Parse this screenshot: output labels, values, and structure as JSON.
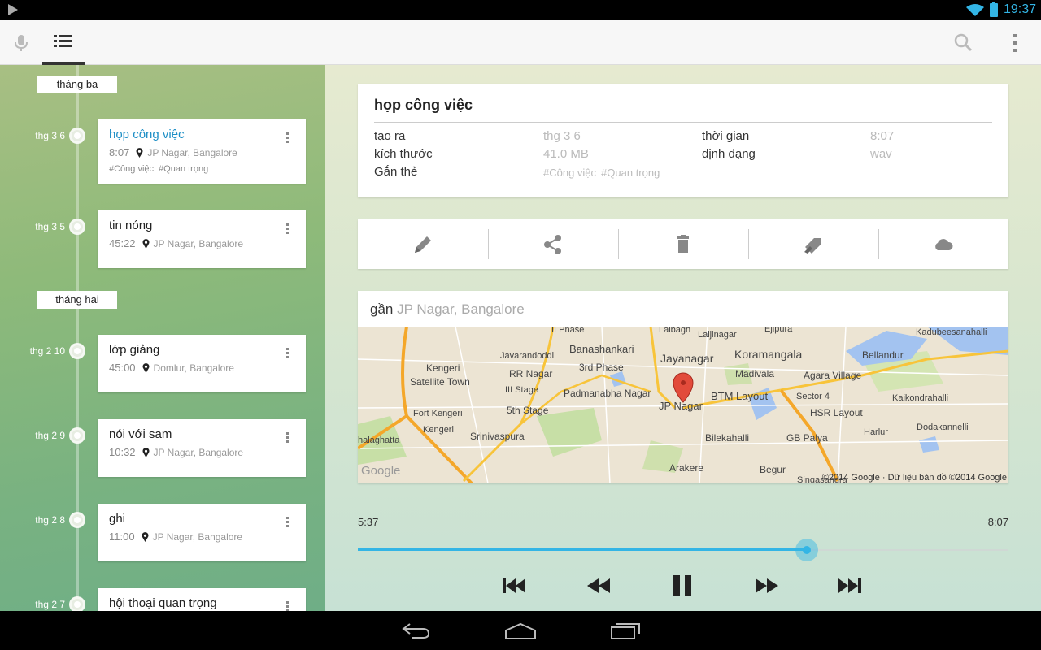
{
  "status_bar": {
    "clock": "19:37",
    "accent": "#33b5e5"
  },
  "toolbar": {
    "left_icons": [
      "mic-icon",
      "list-icon"
    ],
    "right_icons": [
      "search-icon",
      "overflow-menu-icon"
    ]
  },
  "timeline": {
    "months": [
      {
        "label": "tháng ba"
      },
      {
        "label": "tháng hai"
      }
    ],
    "recordings": [
      {
        "date": "thg 3 6",
        "title": "họp công việc",
        "time": "8:07",
        "location": "JP Nagar, Bangalore",
        "tags": [
          "#Công việc",
          "#Quan trọng"
        ],
        "active": true
      },
      {
        "date": "thg 3 5",
        "title": "tin nóng",
        "time": "45:22",
        "location": "JP Nagar, Bangalore"
      },
      {
        "date": "thg 2 10",
        "title": "lớp giảng",
        "time": "45:00",
        "location": "Domlur, Bangalore"
      },
      {
        "date": "thg 2 9",
        "title": "nói với sam",
        "time": "10:32",
        "location": "JP Nagar, Bangalore"
      },
      {
        "date": "thg 2 8",
        "title": "ghi",
        "time": "11:00",
        "location": "JP Nagar, Bangalore"
      },
      {
        "date": "thg 2 7",
        "title": "hội thoại quan trọng"
      }
    ]
  },
  "detail": {
    "title": "họp công việc",
    "created_label": "tạo ra",
    "created_value": "thg 3 6",
    "duration_label": "thời gian",
    "duration_value": "8:07",
    "size_label": "kích thước",
    "size_value": "41.0 MB",
    "format_label": "định dạng",
    "format_value": "wav",
    "tags_label": "Gắn thẻ",
    "tags": [
      "#Công việc",
      "#Quan trọng"
    ]
  },
  "actions": [
    "edit-icon",
    "share-icon",
    "delete-icon",
    "tag-icon",
    "cloud-upload-icon"
  ],
  "map": {
    "near_label": "gần",
    "place": "JP Nagar, Bangalore",
    "labels": [
      "II Phase",
      "Lalbagh",
      "Laljinagar",
      "Ejipura",
      "Kadubeesanahalli",
      "Javarandoddi",
      "Banashankari",
      "Jayanagar",
      "Koramangala",
      "Bellandur",
      "Kengeri",
      "Satellite Town",
      "RR Nagar",
      "3rd Phase",
      "Madivala",
      "Agara Village",
      "III Stage",
      "Padmanabha Nagar",
      "BTM Layout",
      "Sector 4",
      "Kaikondrahalli",
      "Fort Kengeri",
      "Kengeri",
      "5th Stage",
      "JP Nagar",
      "HSR Layout",
      "Harlur",
      "Dodakannelli",
      "halaghatta",
      "Srinivaspura",
      "Bilekahalli",
      "GB Palya",
      "Arakere",
      "Begur",
      "Singasandra",
      "Google"
    ],
    "attribution": "©2014 Google · Dữ liệu bản đồ ©2014 Google"
  },
  "player": {
    "elapsed": "5:37",
    "total": "8:07",
    "progress": 0.69,
    "controls": [
      "skip-previous-icon",
      "rewind-icon",
      "pause-icon",
      "fast-forward-icon",
      "skip-next-icon"
    ]
  },
  "nav_bar": [
    "back-icon",
    "home-icon",
    "recent-apps-icon"
  ]
}
